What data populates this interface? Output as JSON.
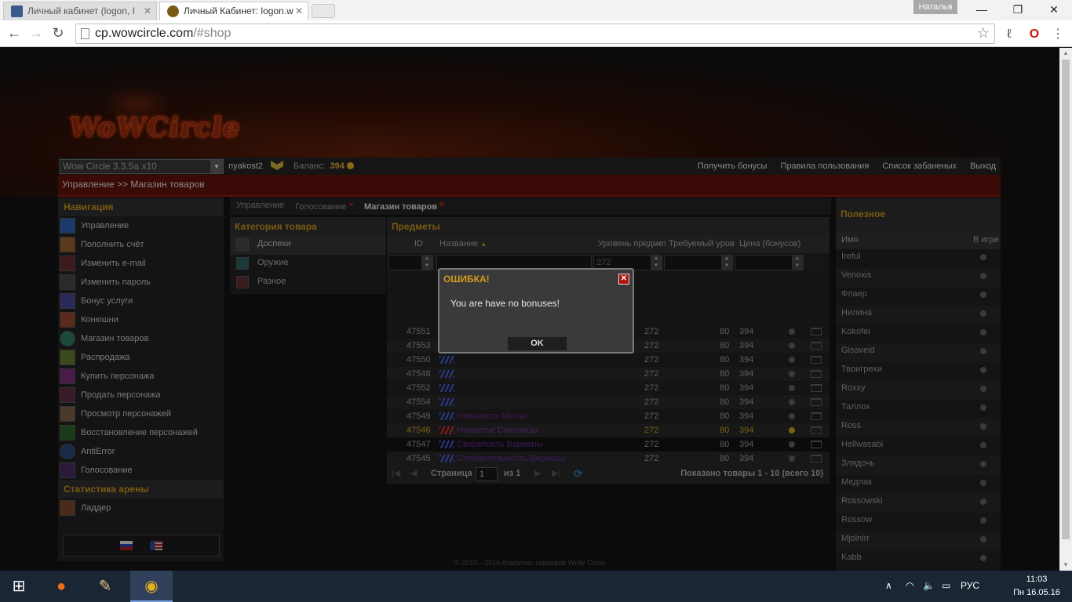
{
  "browser": {
    "tabs": [
      {
        "title": "Личный кабинет (logon, I",
        "active": false
      },
      {
        "title": "Личный Кабинет: logon.w",
        "active": true
      }
    ],
    "profile_name": "Наталья",
    "url_host": "cp.wowcircle.com",
    "url_path": "/#shop"
  },
  "site": {
    "logo_text": "WoWCircle",
    "realm_select": "Wow Circle 3.3.5a x10",
    "username": "nyakost2",
    "balance_label": "Баланс:",
    "balance_value": "394",
    "top_links": [
      "Получить бонусы",
      "Правила пользования",
      "Список забаненых",
      "Выход"
    ],
    "breadcrumb": "Управление >> Магазин товаров",
    "footer": "© 2010—2016 Комплекс серверов WoW Circle"
  },
  "nav": {
    "title": "Навигация",
    "items": [
      "Управление",
      "Пополнить счёт",
      "Изменить e-mail",
      "Изменить пароль",
      "Бонус услуги",
      "Конюшни",
      "Магазин товаров",
      "Распродажа",
      "Купить персонажа",
      "Продать персонажа",
      "Просмотр персонажей",
      "Восстановление персонажей",
      "AntiError",
      "Голосование"
    ],
    "arena_title": "Статистика арены",
    "arena_items": [
      "Ладдер"
    ]
  },
  "content_tabs": [
    "Управление",
    "Голосование",
    "Магазин товаров"
  ],
  "categories": {
    "title": "Категория товара",
    "items": [
      "Доспехи",
      "Оружие",
      "Разное"
    ]
  },
  "items_panel": {
    "title": "Предметы",
    "columns": [
      "ID",
      "Название",
      "Уровень предмета",
      "Требуемый уровень",
      "Цена (бонусов)"
    ],
    "filter_level": "272",
    "rows": [
      {
        "id": "47551",
        "name": "",
        "ilvl": "272",
        "req": "80",
        "price": "394"
      },
      {
        "id": "47553",
        "name": "",
        "ilvl": "272",
        "req": "80",
        "price": "394"
      },
      {
        "id": "47550",
        "name": "",
        "ilvl": "272",
        "req": "80",
        "price": "394"
      },
      {
        "id": "47548",
        "name": "",
        "ilvl": "272",
        "req": "80",
        "price": "394"
      },
      {
        "id": "47552",
        "name": "",
        "ilvl": "272",
        "req": "80",
        "price": "394"
      },
      {
        "id": "47554",
        "name": "",
        "ilvl": "272",
        "req": "80",
        "price": "394"
      },
      {
        "id": "47549",
        "name": "Ненависть Магни",
        "ilvl": "272",
        "req": "80",
        "price": "394"
      },
      {
        "id": "47546",
        "name": "Ненастье Соколицы",
        "ilvl": "272",
        "req": "80",
        "price": "394",
        "highlight": true
      },
      {
        "id": "47547",
        "name": "Свирепость Варианы",
        "ilvl": "272",
        "req": "80",
        "price": "394"
      },
      {
        "id": "47545",
        "name": "Стремительность Вериссы",
        "ilvl": "272",
        "req": "80",
        "price": "394"
      }
    ],
    "pager": {
      "page_label": "Страница",
      "page": "1",
      "of_label": "из 1",
      "shown": "Показано товары 1 - 10 (всего 10)"
    }
  },
  "useful": {
    "title": "Полезное",
    "columns": [
      "Имя",
      "В игре"
    ],
    "players": [
      "Ireful",
      "Venoxis",
      "Флаер",
      "Нилина",
      "Kokofei",
      "Gisaveid",
      "Твоигрехи",
      "Roxxy",
      "Таллох",
      "Ross",
      "Hellwasabi",
      "Злядочь",
      "Медлак",
      "Rossowski",
      "Rossow",
      "Mjolnirr",
      "Kabb"
    ]
  },
  "modal": {
    "title": "ОШИБКА!",
    "message": "You are have no bonuses!",
    "ok_label": "OK"
  },
  "taskbar": {
    "lang": "РУС",
    "time": "11:03",
    "date": "Пн 16.05.16"
  },
  "colors": {
    "accent": "#7a5a12",
    "error_title": "#d49a1a",
    "close_red": "#b01010"
  }
}
